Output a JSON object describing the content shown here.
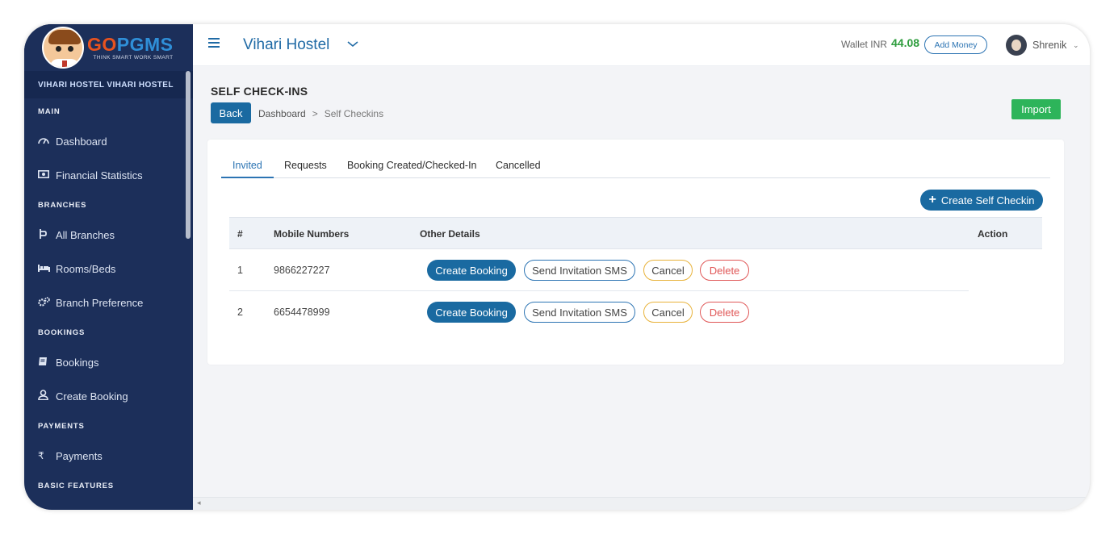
{
  "brand": {
    "logo_go": "GO",
    "logo_pgms": "PGMS",
    "tagline": "THINK SMART WORK SMART"
  },
  "sidebar": {
    "hostel": "VIHARI HOSTEL VIHARI HOSTEL",
    "sections": {
      "main": "MAIN",
      "branches": "BRANCHES",
      "bookings": "BOOKINGS",
      "payments": "PAYMENTS",
      "basic": "BASIC FEATURES"
    },
    "items": {
      "dashboard": "Dashboard",
      "financial": "Financial Statistics",
      "all_branches": "All Branches",
      "rooms": "Rooms/Beds",
      "branch_pref": "Branch Preference",
      "bookings": "Bookings",
      "create_booking": "Create Booking",
      "payments": "Payments"
    }
  },
  "header": {
    "hostel_name": "Vihari Hostel",
    "wallet_label": "Wallet INR",
    "wallet_amount": "44.08",
    "add_money": "Add Money",
    "user": "Shrenik"
  },
  "page": {
    "title": "SELF CHECK-INS",
    "back": "Back",
    "crumb_home": "Dashboard",
    "crumb_sep": ">",
    "crumb_current": "Self Checkins",
    "import": "Import"
  },
  "tabs": [
    "Invited",
    "Requests",
    "Booking Created/Checked-In",
    "Cancelled"
  ],
  "create_self_checkin": "Create Self Checkin",
  "table": {
    "headers": [
      "#",
      "Mobile Numbers",
      "Other Details",
      "Action"
    ],
    "rows": [
      {
        "num": "1",
        "mobile": "9866227227"
      },
      {
        "num": "2",
        "mobile": "6654478999"
      }
    ],
    "actions": {
      "create_booking": "Create Booking",
      "send_sms": "Send Invitation SMS",
      "cancel": "Cancel",
      "delete": "Delete"
    }
  },
  "colors": {
    "sidebar": "#1c2f5a",
    "primary": "#1a6aa1",
    "success": "#2db45a",
    "wallet": "#2e9d3d",
    "danger": "#e05757",
    "warning": "#e8b23a"
  }
}
